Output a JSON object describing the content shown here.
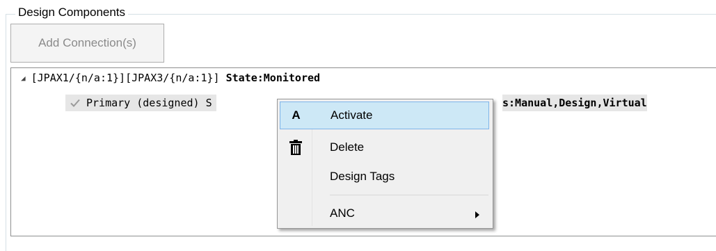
{
  "group": {
    "title": "Design Components"
  },
  "toolbar": {
    "add_connection_label": "Add Connection(s)"
  },
  "tree": {
    "node": {
      "path": "[JPAX1/{n/a:1}][JPAX3/{n/a:1}]",
      "state": "State:Monitored",
      "expander_icon": "triangle-expanded-icon"
    },
    "child": {
      "label_visible": "Primary (designed) S",
      "tags_visible": "s:Manual,Design,Virtual",
      "checked": true
    }
  },
  "context_menu": {
    "items": [
      {
        "label": "Activate",
        "icon": "A",
        "icon_name": "activate-icon",
        "highlighted": true
      },
      {
        "label": "Delete",
        "icon_name": "trash-icon",
        "highlighted": false
      },
      {
        "label": "Design Tags",
        "highlighted": false
      },
      {
        "label": "ANC",
        "has_submenu": true,
        "highlighted": false
      }
    ]
  },
  "colors": {
    "menu_highlight": "#cde8f6",
    "menu_highlight_border": "#7eb4ea",
    "row_selected": "#e6e6e6"
  }
}
